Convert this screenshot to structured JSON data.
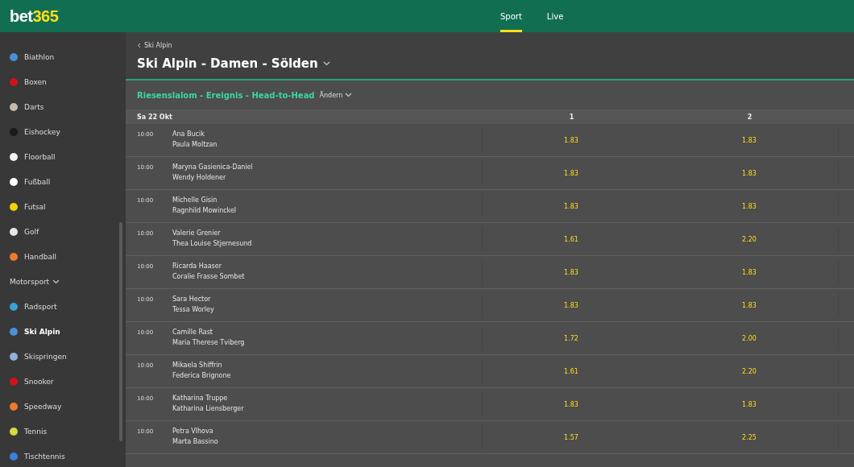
{
  "header": {
    "logo": {
      "text": "bet",
      "accent": "365"
    },
    "tabs": [
      {
        "label": "Sport",
        "selected": true
      },
      {
        "label": "Live",
        "selected": false
      }
    ]
  },
  "sidebar": {
    "items": [
      {
        "kind": "sport",
        "label": "Biathlon",
        "selected": false,
        "color": "#4a90d9"
      },
      {
        "kind": "sport",
        "label": "Boxen",
        "selected": false,
        "color": "#d0121b"
      },
      {
        "kind": "sport",
        "label": "Darts",
        "selected": false,
        "color": "#c8b8a8"
      },
      {
        "kind": "sport",
        "label": "Eishockey",
        "selected": false,
        "color": "#1a1a1a"
      },
      {
        "kind": "sport",
        "label": "Floorball",
        "selected": false,
        "color": "#f2f2f2"
      },
      {
        "kind": "sport",
        "label": "Fußball",
        "selected": false,
        "color": "#ffffff"
      },
      {
        "kind": "sport",
        "label": "Futsal",
        "selected": false,
        "color": "#f5d300"
      },
      {
        "kind": "sport",
        "label": "Golf",
        "selected": false,
        "color": "#e8e8e8"
      },
      {
        "kind": "sport",
        "label": "Handball",
        "selected": false,
        "color": "#f07a2a"
      },
      {
        "kind": "group",
        "label": "Motorsport",
        "selected": false
      },
      {
        "kind": "sport",
        "label": "Radsport",
        "selected": false,
        "color": "#3ba0d8"
      },
      {
        "kind": "sport",
        "label": "Ski Alpin",
        "selected": true,
        "color": "#4a90d9"
      },
      {
        "kind": "sport",
        "label": "Skispringen",
        "selected": false,
        "color": "#8fb0d8"
      },
      {
        "kind": "sport",
        "label": "Snooker",
        "selected": false,
        "color": "#d0121b"
      },
      {
        "kind": "sport",
        "label": "Speedway",
        "selected": false,
        "color": "#f07a2a"
      },
      {
        "kind": "sport",
        "label": "Tennis",
        "selected": false,
        "color": "#d4dc3c"
      },
      {
        "kind": "sport",
        "label": "Tischtennis",
        "selected": false,
        "color": "#3a80e0"
      }
    ]
  },
  "breadcrumb": "Ski Alpin",
  "title": "Ski Alpin - Damen - Sölden",
  "market": {
    "title": "Riesenslalom - Ereignis - Head-to-Head",
    "change": "Ändern"
  },
  "table": {
    "date": "Sa 22 Okt",
    "columns": [
      "1",
      "2"
    ],
    "rows": [
      {
        "time": "10:00",
        "p1": "Ana Bucik",
        "p2": "Paula Moltzan",
        "o1": "1.83",
        "o2": "1.83"
      },
      {
        "time": "10:00",
        "p1": "Maryna Gasienica-Daniel",
        "p2": "Wendy Holdener",
        "o1": "1.83",
        "o2": "1.83"
      },
      {
        "time": "10:00",
        "p1": "Michelle Gisin",
        "p2": "Ragnhild Mowinckel",
        "o1": "1.83",
        "o2": "1.83"
      },
      {
        "time": "10:00",
        "p1": "Valerie Grenier",
        "p2": "Thea Louise Stjernesund",
        "o1": "1.61",
        "o2": "2.20"
      },
      {
        "time": "10:00",
        "p1": "Ricarda Haaser",
        "p2": "Coralie Frasse Sombet",
        "o1": "1.83",
        "o2": "1.83"
      },
      {
        "time": "10:00",
        "p1": "Sara Hector",
        "p2": "Tessa Worley",
        "o1": "1.83",
        "o2": "1.83"
      },
      {
        "time": "10:00",
        "p1": "Camille Rast",
        "p2": "Maria Therese Tviberg",
        "o1": "1.72",
        "o2": "2.00"
      },
      {
        "time": "10:00",
        "p1": "Mikaela Shiffrin",
        "p2": "Federica Brignone",
        "o1": "1.61",
        "o2": "2.20"
      },
      {
        "time": "10:00",
        "p1": "Katharina Truppe",
        "p2": "Katharina Liensberger",
        "o1": "1.83",
        "o2": "1.83"
      },
      {
        "time": "10:00",
        "p1": "Petra Vlhova",
        "p2": "Marta Bassino",
        "o1": "1.57",
        "o2": "2.25"
      }
    ]
  }
}
